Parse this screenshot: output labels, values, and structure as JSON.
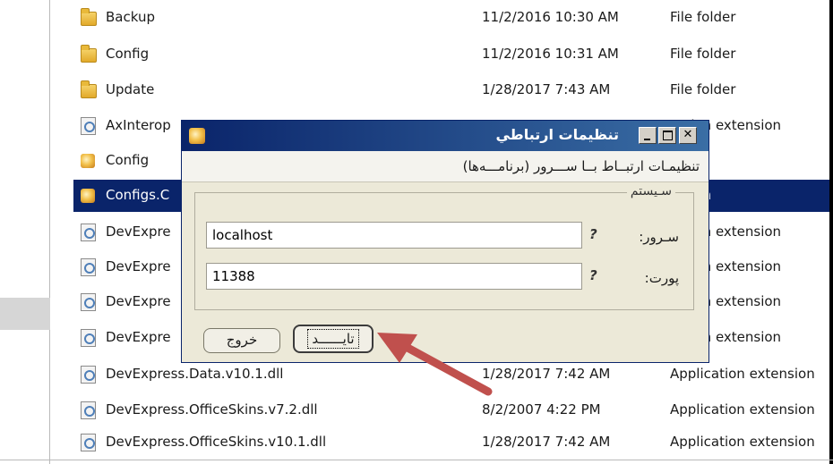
{
  "files": [
    {
      "name": "Backup",
      "date": "11/2/2016 10:30 AM",
      "type": "File folder",
      "icon": "folder-icon"
    },
    {
      "name": "Config",
      "date": "11/2/2016 10:31 AM",
      "type": "File folder",
      "icon": "folder-icon"
    },
    {
      "name": "Update",
      "date": "1/28/2017 7:43 AM",
      "type": "File folder",
      "icon": "folder-icon"
    },
    {
      "name": "AxInterop",
      "date": "",
      "type": "cation extension",
      "icon": "dll-icon"
    },
    {
      "name": "Config",
      "date": "",
      "type": "",
      "icon": "config-icon"
    },
    {
      "name": "Configs.C",
      "date": "",
      "type": "cation",
      "icon": "config-icon",
      "selected": true
    },
    {
      "name": "DevExpre",
      "date": "",
      "type": "cation extension",
      "icon": "dll-icon"
    },
    {
      "name": "DevExpre",
      "date": "",
      "type": "cation extension",
      "icon": "dll-icon"
    },
    {
      "name": "DevExpre",
      "date": "",
      "type": "cation extension",
      "icon": "dll-icon"
    },
    {
      "name": "DevExpre",
      "date": "",
      "type": "cation extension",
      "icon": "dll-icon"
    },
    {
      "name": "DevExpress.Data.v10.1.dll",
      "date": "1/28/2017 7:42 AM",
      "type": "Application extension",
      "icon": "dll-icon"
    },
    {
      "name": "DevExpress.OfficeSkins.v7.2.dll",
      "date": "8/2/2007 4:22 PM",
      "type": "Application extension",
      "icon": "dll-icon"
    },
    {
      "name": "DevExpress.OfficeSkins.v10.1.dll",
      "date": "1/28/2017 7:42 AM",
      "type": "Application extension",
      "icon": "dll-icon"
    }
  ],
  "dialog": {
    "title": "تنظيمات ارتباطي",
    "menu": "تنظيمـات ارتبــاط بــا ســـرور (برنامـــه‌ها)",
    "group_label": "سـيستم",
    "server_label": "سـرور:",
    "server_value": "localhost",
    "port_label": "پورت:",
    "port_value": "11388",
    "help_mark": "?",
    "ok_label": "تايــــــد",
    "exit_label": "خروج"
  },
  "colors": {
    "selection": "#0a246a",
    "annotation_arrow": "#c0504d"
  }
}
